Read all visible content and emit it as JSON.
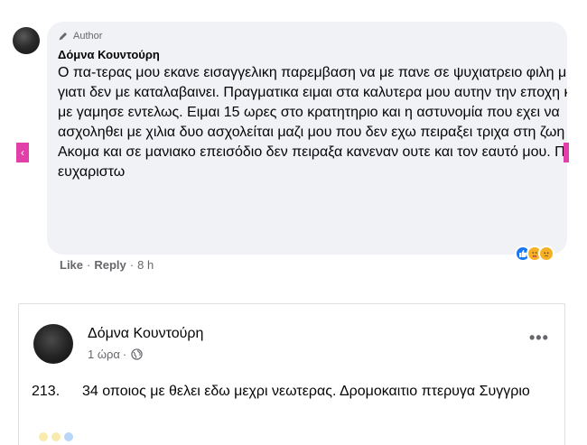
{
  "comment": {
    "badge": "Author",
    "author": "Δόμνα Κουντούρη",
    "text": "Ο πα-τερας μου εκανε εισαγγελικη παρεμβαση να με πανε σε ψυχιατρειο φιλη μου γιατι δεν με καταλαβαινει. Πραγματικα ειμαι στα καλυτερα μου αυτην την εποχη και με γαμησε εντελως. Ειμαι 15 ωρες στο κρατητηριο και η αστυνομία που εχει να ασχοληθει με χιλια δυο ασχολείται μαζι μου που δεν εχω πειραξει τριχα στη ζωη μου. Ακομα και σε μανιακο επεισόδιο δεν πειραξα κανεναν ουτε και τον εαυτό μου. Πενυ σ ευχαριστω",
    "actions": {
      "like": "Like",
      "reply": "Reply",
      "time": "8 h"
    },
    "nav_left": "‹"
  },
  "post": {
    "author": "Δόμνα Κουντούρη",
    "time": "1 ώρα",
    "more": "•••",
    "number": "213.",
    "text": "34 οποιος με θελει εδω μεχρι νεωτερας. Δρομοκαιτιο πτερυγα Συγγριο"
  },
  "icons": {
    "badge": "pencil-icon",
    "privacy": "globe-icon",
    "reactions": [
      "like-reaction-icon",
      "care-reaction-icon",
      "sad-reaction-icon"
    ]
  },
  "colors": {
    "bubble": "#f0f2f5",
    "secondary_text": "#65676b",
    "like_blue": "#1877f2",
    "nav_marker": "#e040a8"
  }
}
